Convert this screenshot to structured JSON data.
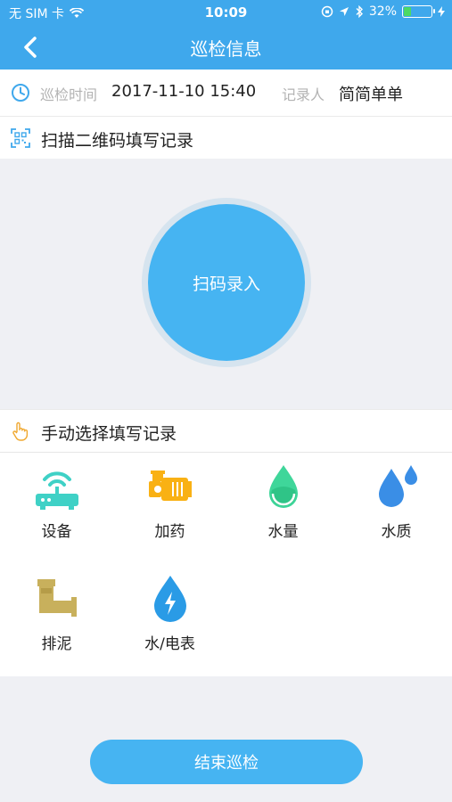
{
  "status_bar": {
    "carrier": "无 SIM 卡",
    "time": "10:09",
    "battery": "32%",
    "battery_level": 0.32
  },
  "nav": {
    "title": "巡检信息"
  },
  "info": {
    "time_label": "巡检时间",
    "time_value": "2017-11-10 15:40",
    "recorder_label": "记录人",
    "recorder_value": "简简单单"
  },
  "scan_section": {
    "title": "扫描二维码填写记录",
    "button_label": "扫码录入"
  },
  "manual_section": {
    "title": "手动选择填写记录",
    "items": [
      {
        "label": "设备",
        "icon": "router-icon"
      },
      {
        "label": "加药",
        "icon": "pump-icon"
      },
      {
        "label": "水量",
        "icon": "water-drop-icon"
      },
      {
        "label": "水质",
        "icon": "water-drops-icon"
      },
      {
        "label": "排泥",
        "icon": "pipe-icon"
      },
      {
        "label": "水/电表",
        "icon": "water-electric-icon"
      }
    ]
  },
  "footer": {
    "end_button": "结束巡检"
  },
  "colors": {
    "primary": "#3fa8ec",
    "button": "#46b4f2",
    "teal": "#3fd1c6",
    "orange": "#f9b114",
    "green": "#3fd69a",
    "blue_drop": "#3a8ee6",
    "olive": "#c8b05c"
  }
}
